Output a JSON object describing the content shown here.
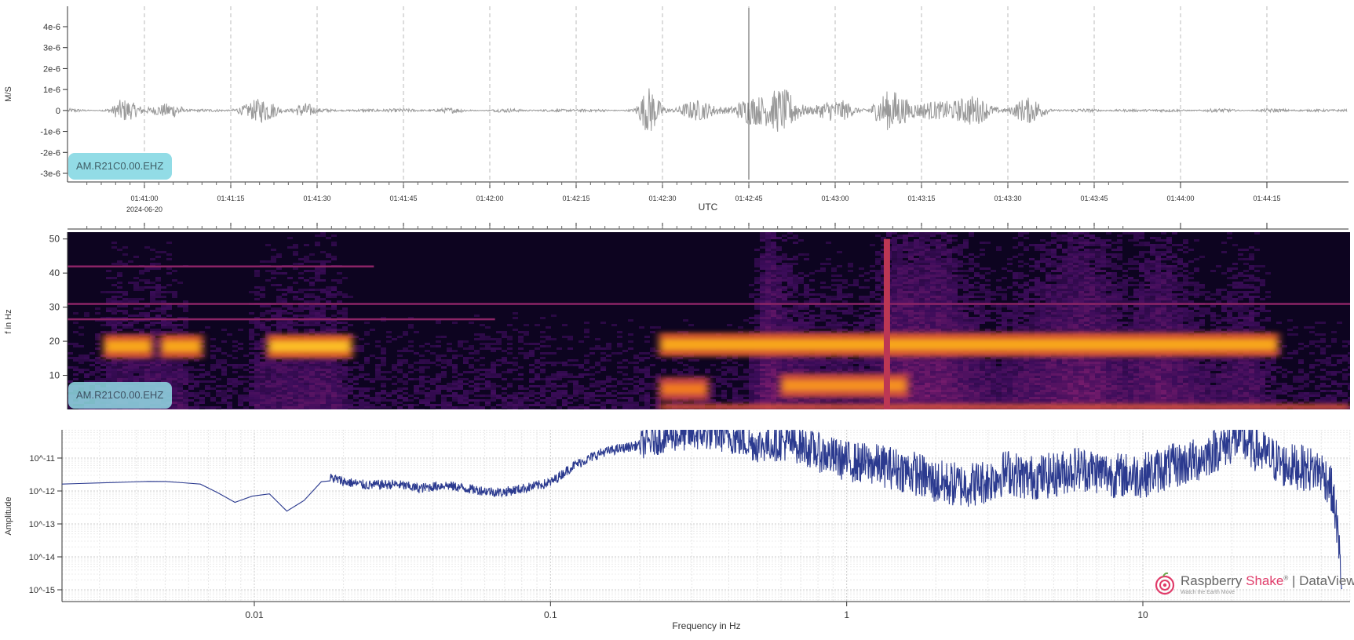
{
  "chart_data": [
    {
      "type": "line",
      "panel": "waveform",
      "ylabel": "M/S",
      "xlabel": "UTC",
      "ylim": [
        -3.5e-06,
        5e-06
      ],
      "yticks": [
        "4e-6",
        "3e-6",
        "2e-6",
        "1e-6",
        "0",
        "-1e-6",
        "-2e-6",
        "-3e-6"
      ],
      "ytick_values": [
        4e-06,
        3e-06,
        2e-06,
        1e-06,
        0,
        -1e-06,
        -2e-06,
        -3e-06
      ],
      "xticks": [
        "01:41:00",
        "01:41:15",
        "01:41:30",
        "01:41:45",
        "01:42:00",
        "01:42:15",
        "01:42:30",
        "01:42:45",
        "01:43:00",
        "01:43:15",
        "01:43:30",
        "01:43:45",
        "01:44:00",
        "01:44:15"
      ],
      "date_label": "2024-06-20",
      "station": "AM.R21C0.00.EHZ",
      "color": "#999999",
      "grid": "vertical-dashed",
      "envelope": {
        "time_s": [
          0,
          4,
          6,
          10,
          12,
          16,
          17,
          25,
          26,
          37,
          40,
          41,
          45,
          46,
          60,
          70,
          80,
          95,
          98,
          100,
          105,
          112,
          115,
          120,
          125,
          130,
          135,
          140,
          143,
          148,
          153,
          160,
          162,
          166,
          170,
          176,
          180
        ],
        "amplitude": [
          1e-07,
          2e-07,
          6e-07,
          5e-07,
          6.5e-07,
          5e-07,
          1e-07,
          1e-07,
          5.5e-07,
          7e-07,
          1e-07,
          1.5e-07,
          1e-07,
          1e-07,
          1.5e-07,
          1e-07,
          1e-07,
          1e-07,
          1.4e-06,
          9e-07,
          5.5e-07,
          5e-07,
          1.1e-06,
          1.6e-06,
          9e-07,
          5e-07,
          8e-07,
          1.1e-06,
          1.2e-06,
          7e-07,
          1.1e-06,
          4e-07,
          6e-07,
          7e-07,
          1e-07,
          1e-07,
          1e-07
        ]
      },
      "spike": {
        "time_s": 115,
        "min": -3.3e-06,
        "max": 4.9e-06
      }
    },
    {
      "type": "heatmap",
      "panel": "spectrogram",
      "ylabel": "f in Hz",
      "ylim": [
        0,
        50
      ],
      "yticks": [
        "50",
        "40",
        "30",
        "20",
        "10"
      ],
      "ytick_values": [
        50,
        40,
        30,
        20,
        10
      ],
      "station": "AM.R21C0.00.EHZ",
      "colormap": "inferno",
      "bands": [
        {
          "t0": 5,
          "t1": 12,
          "f": 18.5,
          "intensity": 0.8
        },
        {
          "t0": 13,
          "t1": 19,
          "f": 18.5,
          "intensity": 0.8
        },
        {
          "t0": 28,
          "t1": 40,
          "f": 18.5,
          "intensity": 0.85
        },
        {
          "t0": 83,
          "t1": 170,
          "f": 19,
          "intensity": 0.8
        },
        {
          "t0": 100,
          "t1": 118,
          "f": 7,
          "intensity": 0.75
        },
        {
          "t0": 83,
          "t1": 90,
          "f": 6,
          "intensity": 0.7
        }
      ],
      "lines": [
        {
          "f": 42,
          "t0": 0,
          "t1": 43
        },
        {
          "f": 31,
          "t0": 0,
          "t1": 180
        },
        {
          "f": 26.5,
          "t0": 0,
          "t1": 60
        }
      ],
      "spike": {
        "time_s": 115,
        "f_max": 50
      }
    },
    {
      "type": "line",
      "panel": "spectrum",
      "xlabel": "Frequency in Hz",
      "ylabel": "Amplitude",
      "xscale": "log",
      "yscale": "log",
      "xlim": [
        0.001,
        50
      ],
      "ylim": [
        4e-16,
        1e-10
      ],
      "xticks": [
        "0.01",
        "0.1",
        "1",
        "10"
      ],
      "xtick_values": [
        0.01,
        0.1,
        1,
        10
      ],
      "yticks": [
        "10^-11",
        "10^-12",
        "10^-13",
        "10^-14",
        "10^-15"
      ],
      "ytick_values": [
        1e-11,
        1e-12,
        1e-13,
        1e-14,
        1e-15
      ],
      "color": "#2b3a8f",
      "grid": "log-dotted",
      "x": [
        0.001,
        0.0048,
        0.0067,
        0.0086,
        0.011,
        0.0134,
        0.0163,
        0.0182,
        0.0202,
        0.024,
        0.03,
        0.036,
        0.044,
        0.055,
        0.068,
        0.085,
        0.1,
        0.12,
        0.15,
        0.2,
        0.25,
        0.3,
        0.35,
        0.4,
        0.5,
        0.6,
        0.7,
        0.8,
        1.0,
        1.3,
        1.7,
        2.0,
        2.5,
        3.0,
        3.5,
        4.0,
        5.0,
        6.0,
        7.0,
        8.0,
        10.0,
        12.0,
        15.0,
        18.0,
        21.0,
        25.0,
        30.0,
        35.0,
        40.0,
        43.0,
        45.0,
        47.0
      ],
      "y": [
        1.3e-12,
        2e-12,
        1.6e-12,
        4.5e-13,
        1e-12,
        1.7e-13,
        1.7e-12,
        2.5e-12,
        1.9e-12,
        1.5e-12,
        1.6e-12,
        1.2e-12,
        1.5e-12,
        1.1e-12,
        9e-13,
        1.3e-12,
        1.8e-12,
        6e-12,
        1.5e-11,
        2.5e-11,
        4.5e-11,
        5e-11,
        5.5e-11,
        4.5e-11,
        2.5e-11,
        3e-11,
        2.5e-11,
        1.5e-11,
        8e-12,
        6e-12,
        3.5e-12,
        1.8e-12,
        1.5e-12,
        2e-12,
        4e-12,
        2.5e-12,
        3e-12,
        5e-12,
        4e-12,
        3e-12,
        3e-12,
        5e-12,
        8e-12,
        2e-11,
        4e-11,
        1.5e-11,
        6e-12,
        5e-12,
        4e-12,
        1.5e-12,
        1.5e-13,
        1.5e-15
      ],
      "noise_start_hz": 0.2
    }
  ],
  "logo": {
    "brand_main": "Raspberry ",
    "brand_accent": "Shake",
    "brand_mark": "®",
    "brand_suffix": " | DataView",
    "tagline": "Watch the Earth Move",
    "accent_color": "#e03c6a"
  }
}
